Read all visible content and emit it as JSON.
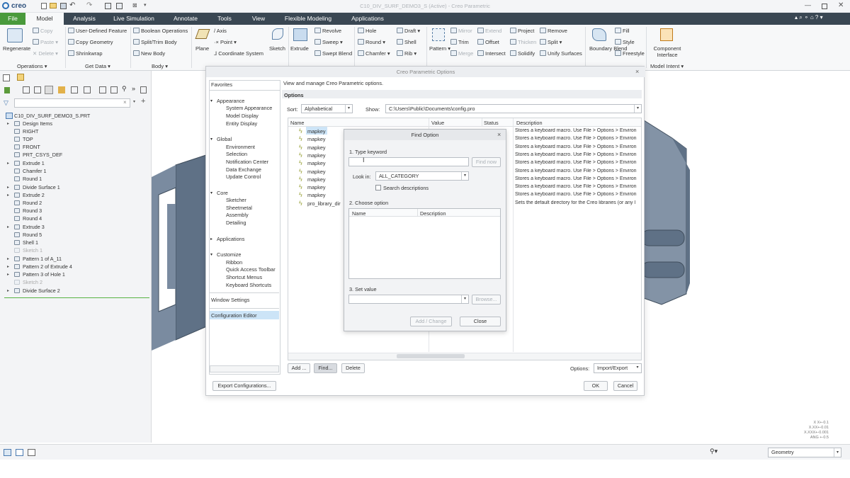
{
  "window_title": "C10_DIV_SURF_DEMO3_S (Active) - Creo Parametric",
  "app_logo": "creo",
  "menu_tabs": [
    "File",
    "Model",
    "Analysis",
    "Live Simulation",
    "Annotate",
    "Tools",
    "View",
    "Flexible Modeling",
    "Applications"
  ],
  "ribbon": {
    "regenerate": "Regenerate",
    "copy": "Copy",
    "paste": "Paste",
    "delete": "Delete",
    "operations": "Operations",
    "udf": "User-Defined Feature",
    "copy_geometry": "Copy Geometry",
    "shrinkwrap": "Shrinkwrap",
    "get_data": "Get Data",
    "boolean": "Boolean Operations",
    "split_trim": "Split/Trim Body",
    "new_body": "New Body",
    "body": "Body",
    "plane": "Plane",
    "axis": "Axis",
    "point": "Point",
    "coord_sys": "Coordinate System",
    "sketch": "Sketch",
    "extrude": "Extrude",
    "revolve": "Revolve",
    "sweep": "Sweep",
    "swept_blend": "Swept Blend",
    "hole": "Hole",
    "round": "Round",
    "chamfer": "Chamfer",
    "draft": "Draft",
    "shell": "Shell",
    "rib": "Rib",
    "pattern": "Pattern",
    "mirror": "Mirror",
    "trim": "Trim",
    "merge": "Merge",
    "extend": "Extend",
    "offset": "Offset",
    "intersect": "Intersect",
    "project": "Project",
    "thicken": "Thicken",
    "solidify": "Solidify",
    "remove": "Remove",
    "split": "Split",
    "unify": "Unify Surfaces",
    "boundary_blend": "Boundary Blend",
    "fill": "Fill",
    "style": "Style",
    "freestyle": "Freestyle",
    "component_interface": "Component Interface",
    "model_intent": "Model Intent"
  },
  "tree": {
    "search_placeholder": "",
    "root": "C10_DIV_SURF_DEMO3_S.PRT",
    "items": [
      "Design Items",
      "RIGHT",
      "TOP",
      "FRONT",
      "PRT_CSYS_DEF",
      "Extrude 1",
      "Chamfer 1",
      "Round 1",
      "Divide Surface 1",
      "Extrude 2",
      "Round 2",
      "Round 3",
      "Round 4",
      "Extrude 3",
      "Round 5",
      "Shell 1",
      "Sketch 1",
      "Pattern 1 of A_11",
      "Pattern 2 of Extrude 4",
      "Pattern 3 of Hole 1",
      "Sketch 2",
      "Divide Surface 2"
    ]
  },
  "options_dialog": {
    "title": "Creo Parametric Options",
    "nav": {
      "favorites": "Favorites",
      "appearance": "Appearance",
      "system_appearance": "System Appearance",
      "model_display": "Model Display",
      "entity_display": "Entity Display",
      "global": "Global",
      "environment": "Environment",
      "selection": "Selection",
      "notification_center": "Notification Center",
      "data_exchange": "Data Exchange",
      "update_control": "Update Control",
      "core": "Core",
      "sketcher": "Sketcher",
      "sheetmetal": "Sheetmetal",
      "assembly": "Assembly",
      "detailing": "Detailing",
      "applications": "Applications",
      "customize": "Customize",
      "ribbon": "Ribbon",
      "quick_access_toolbar": "Quick Access Toolbar",
      "shortcut_menus": "Shortcut Menus",
      "keyboard_shortcuts": "Keyboard Shortcuts",
      "window_settings": "Window Settings",
      "configuration_editor": "Configuration Editor"
    },
    "intro": "View and manage Creo Parametric options.",
    "options_heading": "Options",
    "sort_label": "Sort:",
    "sort_value": "Alphabetical",
    "show_label": "Show:",
    "show_value": "C:\\Users\\Public\\Documents\\config.pro",
    "columns": [
      "Name",
      "Value",
      "Status",
      "Description"
    ],
    "rows": [
      {
        "name": "mapkey",
        "desc": "Stores a keyboard macro. Use File > Options > Environ"
      },
      {
        "name": "mapkey",
        "desc": "Stores a keyboard macro. Use File > Options > Environ"
      },
      {
        "name": "mapkey",
        "desc": "Stores a keyboard macro. Use File > Options > Environ"
      },
      {
        "name": "mapkey",
        "desc": "Stores a keyboard macro. Use File > Options > Environ"
      },
      {
        "name": "mapkey",
        "desc": "Stores a keyboard macro. Use File > Options > Environ"
      },
      {
        "name": "mapkey",
        "desc": "Stores a keyboard macro. Use File > Options > Environ"
      },
      {
        "name": "mapkey",
        "desc": "Stores a keyboard macro. Use File > Options > Environ"
      },
      {
        "name": "mapkey",
        "desc": "Stores a keyboard macro. Use File > Options > Environ"
      },
      {
        "name": "mapkey",
        "desc": "Stores a keyboard macro. Use File > Options > Environ"
      },
      {
        "name": "pro_library_dir",
        "desc": "Sets the default directory for the Creo libraries (or any l"
      }
    ],
    "add": "Add ...",
    "find": "Find...",
    "delete": "Delete",
    "options_label": "Options:",
    "import_export": "Import/Export",
    "export_config": "Export Configurations...",
    "ok": "OK",
    "cancel": "Cancel"
  },
  "find_dialog": {
    "title": "Find Option",
    "step1": "1.  Type keyword",
    "keyword_value": "",
    "find_now": "Find now",
    "look_in_label": "Look in:",
    "look_in_value": "ALL_CATEGORY",
    "search_desc": "Search descriptions",
    "step2": "2.  Choose option",
    "col_name": "Name",
    "col_desc": "Description",
    "step3": "3.  Set value",
    "set_value": "",
    "browse": "Browse...",
    "add_change": "Add / Change",
    "close": "Close"
  },
  "status": {
    "filter_value": "Geometry",
    "coords": [
      "X X+-0.1",
      "X.XX+-0.01",
      "X.XXX+-0.001",
      "ANG +-0.5"
    ]
  },
  "colors": {
    "menubar": "#3a4753",
    "file_tab": "#4a9a3c",
    "selection": "#cce4f7",
    "model_body": "#6f7f92"
  }
}
